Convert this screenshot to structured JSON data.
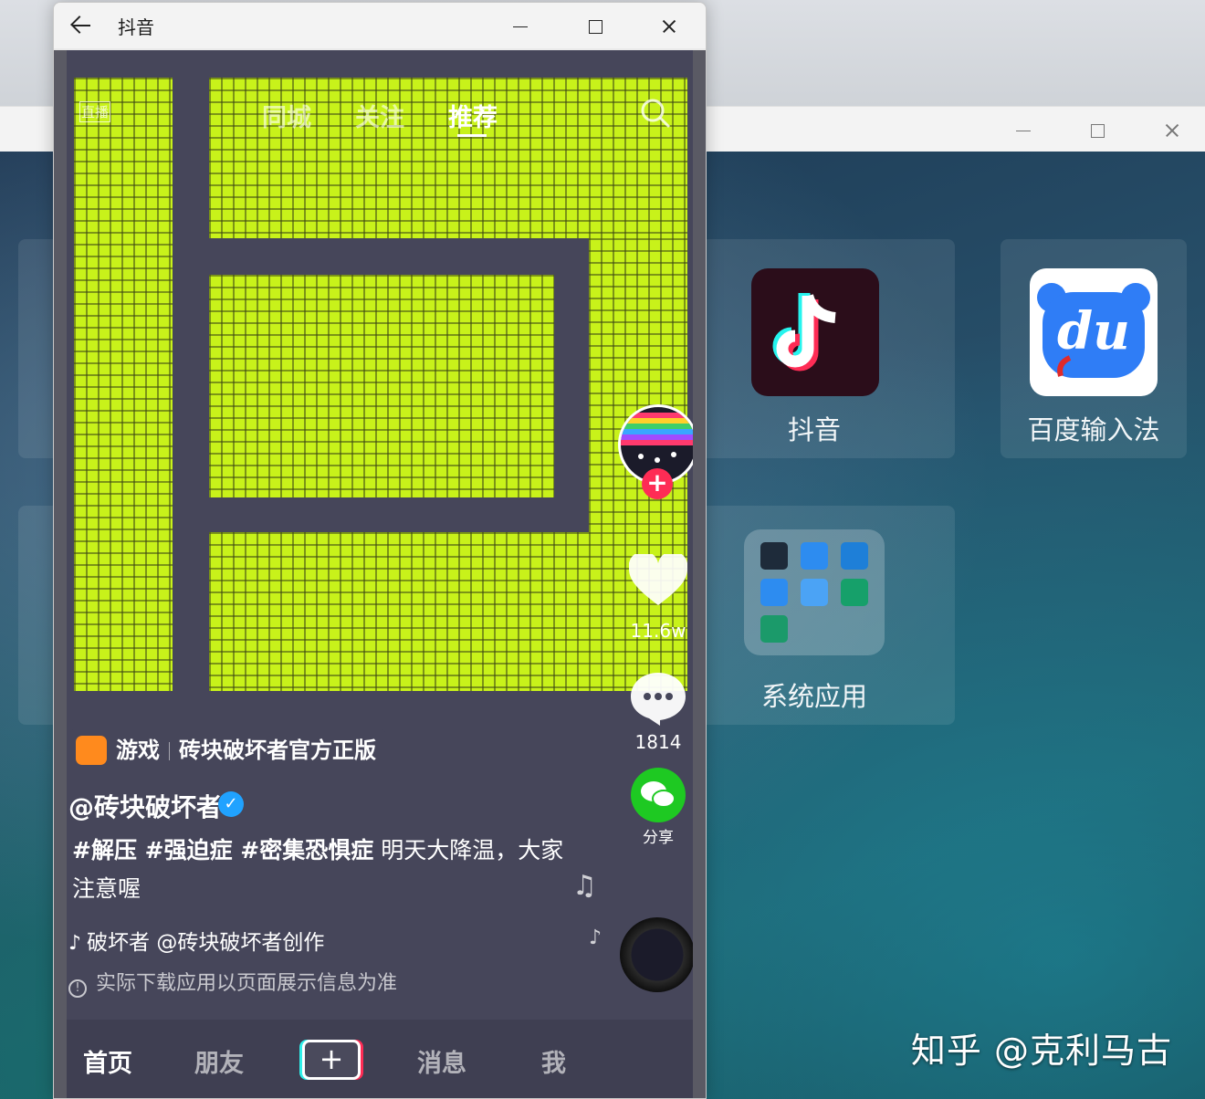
{
  "background_window": {
    "apps": [
      {
        "label": "抖音",
        "icon": "douyin-icon"
      },
      {
        "label": "百度输入法",
        "icon": "baidu-input-icon",
        "icon_text": "du"
      },
      {
        "label": "系统应用",
        "icon": "system-apps-folder-icon"
      }
    ]
  },
  "watermark": "知乎 @克利马古",
  "window": {
    "title": "抖音"
  },
  "top_tabs": [
    {
      "label": "同城",
      "active": false
    },
    {
      "label": "关注",
      "active": false
    },
    {
      "label": "推荐",
      "active": true
    }
  ],
  "live_label": "直播",
  "side_actions": {
    "likes": "11.6w",
    "comments": "1814",
    "share": "分享"
  },
  "game_tag": {
    "category": "游戏",
    "name": "砖块破坏者官方正版"
  },
  "author": "@砖块破坏者",
  "description": {
    "hashtags": "#解压 #强迫症 #密集恐惧症",
    "text": " 明天大降温，大家注意喔"
  },
  "music": "破坏者    @砖块破坏者创作",
  "notice": "实际下载应用以页面展示信息为准",
  "bottom_nav": [
    {
      "label": "首页",
      "active": true
    },
    {
      "label": "朋友",
      "active": false
    },
    {
      "label": "消息",
      "active": false
    },
    {
      "label": "我",
      "active": false
    }
  ],
  "create_button": "+",
  "colors": {
    "brick": "#c8f21a",
    "background": "#46465a",
    "accent_red": "#fe2c55",
    "verify_blue": "#20a2ff",
    "wechat_green": "#1ec922"
  }
}
